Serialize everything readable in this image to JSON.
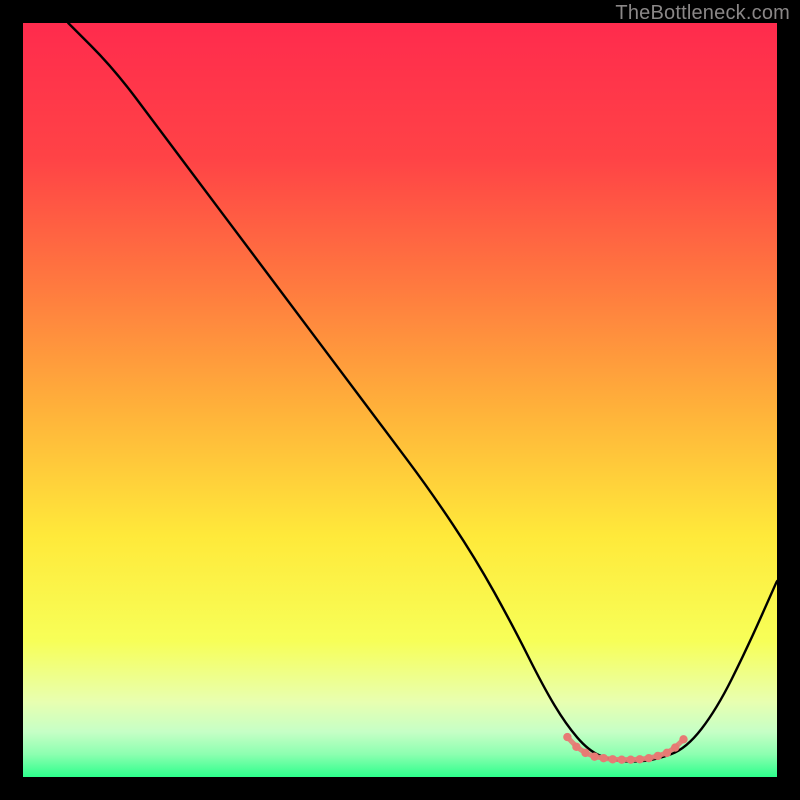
{
  "attribution": "TheBottleneck.com",
  "chart_data": {
    "type": "line",
    "title": "",
    "xlabel": "",
    "ylabel": "",
    "xlim": [
      0,
      100
    ],
    "ylim": [
      0,
      100
    ],
    "gradient_stops": [
      {
        "offset": 0,
        "color": "#ff2b4d"
      },
      {
        "offset": 18,
        "color": "#ff4346"
      },
      {
        "offset": 35,
        "color": "#ff7a3f"
      },
      {
        "offset": 52,
        "color": "#ffb43a"
      },
      {
        "offset": 68,
        "color": "#ffe93a"
      },
      {
        "offset": 82,
        "color": "#f7ff58"
      },
      {
        "offset": 90,
        "color": "#e8ffb0"
      },
      {
        "offset": 94,
        "color": "#c6ffc6"
      },
      {
        "offset": 97,
        "color": "#8cffb0"
      },
      {
        "offset": 100,
        "color": "#2dff8c"
      }
    ],
    "series": [
      {
        "name": "bottleneck-curve",
        "x": [
          6,
          12,
          18,
          24,
          30,
          36,
          42,
          48,
          54,
          60,
          65,
          69,
          72,
          75,
          78,
          81,
          84,
          88,
          92,
          96,
          100
        ],
        "y": [
          100,
          94,
          86,
          78,
          70,
          62,
          54,
          46,
          38,
          29,
          20,
          12,
          7,
          3.5,
          2.2,
          2.0,
          2.3,
          3.8,
          9,
          17,
          26
        ]
      }
    ],
    "marker_points": {
      "color": "#e77a74",
      "x": [
        72.2,
        73.4,
        74.6,
        75.8,
        77.0,
        78.2,
        79.4,
        80.6,
        81.8,
        83.0,
        84.2,
        85.4,
        86.5,
        87.6
      ],
      "y": [
        5.3,
        4.0,
        3.2,
        2.7,
        2.5,
        2.35,
        2.3,
        2.3,
        2.35,
        2.5,
        2.8,
        3.2,
        3.9,
        5.0
      ]
    }
  }
}
